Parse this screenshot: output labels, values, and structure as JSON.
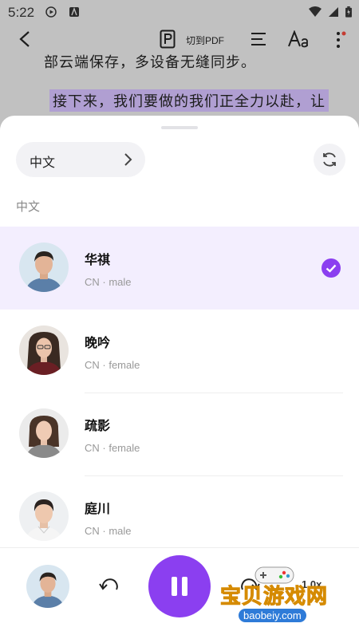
{
  "status_bar": {
    "time": "5:22"
  },
  "toolbar": {
    "pdf_label": "切到PDF"
  },
  "document": {
    "line1": "部云端保存，多设备无缝同步。",
    "line2": "接下来，我们要做的我们正全力以赴，让"
  },
  "sheet": {
    "language_selector": "中文",
    "section_label": "中文",
    "voices": [
      {
        "name": "华祺",
        "meta": "CN · male",
        "selected": true
      },
      {
        "name": "晚吟",
        "meta": "CN · female",
        "selected": false
      },
      {
        "name": "疏影",
        "meta": "CN · female",
        "selected": false
      },
      {
        "name": "庭川",
        "meta": "CN · male",
        "selected": false
      }
    ]
  },
  "player": {
    "speed": "1.0x"
  },
  "watermark": {
    "text": "宝贝游戏网",
    "url": "baobeiy.com"
  },
  "colors": {
    "accent": "#8b3ff0",
    "selected_bg": "#f3eefe",
    "highlight": "#c9b6ef"
  }
}
